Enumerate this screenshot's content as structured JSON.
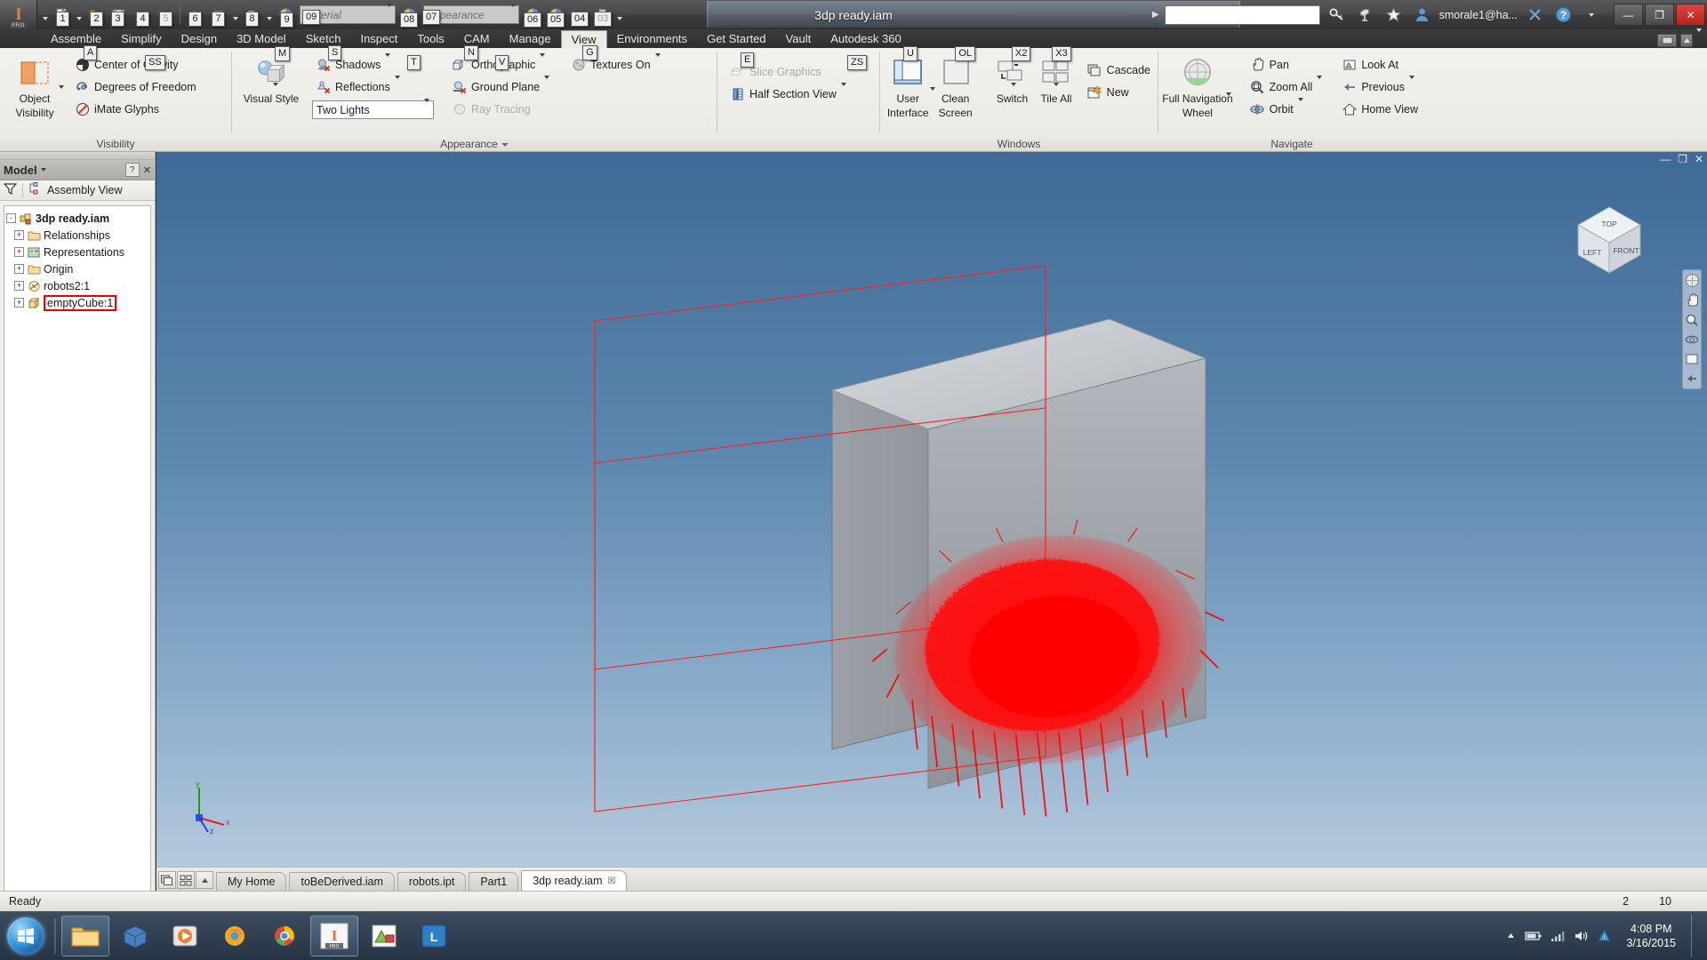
{
  "window": {
    "title": "3dp ready.iam",
    "user": "smorale1@ha...",
    "search_placeholder": "",
    "buttons": {
      "minimize": "—",
      "maximize": "❐",
      "close": "✕"
    }
  },
  "qat": {
    "material_placeholder": "Material",
    "appearance_placeholder": "Appearance",
    "keytips": [
      "1",
      "2",
      "3",
      "4",
      "5",
      "6",
      "7",
      "8",
      "9",
      "09",
      "08",
      "07",
      "06",
      "05",
      "04",
      "03"
    ]
  },
  "ribbon_tabs": [
    {
      "label": "Assemble",
      "active": false
    },
    {
      "label": "Simplify",
      "active": false
    },
    {
      "label": "Design",
      "active": false
    },
    {
      "label": "3D Model",
      "active": false
    },
    {
      "label": "Sketch",
      "active": false
    },
    {
      "label": "Inspect",
      "active": false
    },
    {
      "label": "Tools",
      "active": false
    },
    {
      "label": "CAM",
      "active": false
    },
    {
      "label": "Manage",
      "active": false
    },
    {
      "label": "View",
      "active": true
    },
    {
      "label": "Environments",
      "active": false
    },
    {
      "label": "Get Started",
      "active": false
    },
    {
      "label": "Vault",
      "active": false
    },
    {
      "label": "Autodesk 360",
      "active": false
    }
  ],
  "panels": [
    {
      "title": "Visibility",
      "big": {
        "label_line1": "Object",
        "label_line2": "Visibility",
        "icon": "object-visibility-icon",
        "keytip": null
      },
      "items": [
        {
          "label": "Center of Gravity",
          "icon": "center-of-gravity-icon",
          "keytip": "A",
          "arrow": false,
          "disabled": false
        },
        {
          "label": "Degrees of Freedom",
          "icon": "degrees-of-freedom-icon",
          "keytip": "SS",
          "arrow": false,
          "disabled": false
        },
        {
          "label": "iMate Glyphs",
          "icon": "imate-glyphs-icon",
          "keytip": null,
          "arrow": false,
          "disabled": false
        }
      ]
    },
    {
      "title": "Appearance",
      "has_title_arrow": true,
      "big": {
        "label_line1": "Visual Style",
        "label_line2": "",
        "icon": "visual-style-icon",
        "keytip": "M",
        "caret": true
      },
      "columns": [
        [
          {
            "label": "Shadows",
            "icon": "shadows-icon",
            "keytip": "S",
            "arrow": true,
            "disabled": false
          },
          {
            "label": "Reflections",
            "icon": "reflections-icon",
            "keytip": null,
            "arrow": true,
            "disabled": false
          },
          {
            "label": "Two Lights",
            "type": "combo",
            "keytip": null
          }
        ],
        [
          {
            "label": "Orthographic",
            "icon": "orthographic-icon",
            "keytip": "N",
            "arrow": true,
            "disabled": false
          },
          {
            "label": "Ground Plane",
            "icon": "ground-plane-icon",
            "keytip": "T",
            "arrow": true,
            "disabled": false
          },
          {
            "label": "Ray Tracing",
            "icon": "ray-tracing-icon",
            "keytip": null,
            "arrow": false,
            "disabled": true
          }
        ],
        [
          {
            "label": "Textures On",
            "icon": "textures-on-icon",
            "keytip": "G",
            "arrow": true,
            "disabled": false
          }
        ]
      ],
      "extra_keytip": "V"
    },
    {
      "title": "",
      "items": [
        {
          "label": "Slice Graphics",
          "icon": "slice-graphics-icon",
          "keytip": "E",
          "arrow": false,
          "disabled": true
        },
        {
          "label": "Half Section View",
          "icon": "half-section-view-icon",
          "keytip": "ZS",
          "arrow": true,
          "disabled": false
        }
      ]
    },
    {
      "title": "Windows",
      "bigs": [
        {
          "label_line1": "User",
          "label_line2": "Interface",
          "icon": "user-interface-icon",
          "keytip": "U",
          "caret": true
        },
        {
          "label_line1": "Clean",
          "label_line2": "Screen",
          "icon": "clean-screen-icon",
          "keytip": "OL",
          "caret": false
        },
        {
          "label_line1": "Switch",
          "label_line2": "",
          "icon": "switch-windows-icon",
          "keytip": "X2",
          "caret": true
        },
        {
          "label_line1": "Tile All",
          "label_line2": "",
          "icon": "tile-all-icon",
          "keytip": "X3",
          "caret": true
        }
      ],
      "items": [
        {
          "label": "Cascade",
          "icon": "cascade-icon",
          "keytip": null,
          "arrow": false,
          "disabled": false
        },
        {
          "label": "New",
          "icon": "new-window-icon",
          "keytip": null,
          "arrow": false,
          "disabled": false
        }
      ]
    },
    {
      "title": "Navigate",
      "big": {
        "label_line1": "Full Navigation",
        "label_line2": "Wheel",
        "icon": "navigation-wheel-icon",
        "keytip": null,
        "caret": true
      },
      "columns": [
        [
          {
            "label": "Pan",
            "icon": "pan-icon",
            "keytip": null,
            "arrow": false,
            "disabled": false
          },
          {
            "label": "Zoom All",
            "icon": "zoom-all-icon",
            "keytip": null,
            "arrow": true,
            "disabled": false
          },
          {
            "label": "Orbit",
            "icon": "orbit-icon",
            "keytip": null,
            "arrow": true,
            "disabled": false
          }
        ],
        [
          {
            "label": "Look At",
            "icon": "look-at-icon",
            "keytip": null,
            "arrow": false,
            "disabled": false
          },
          {
            "label": "Previous",
            "icon": "previous-view-icon",
            "keytip": null,
            "arrow": true,
            "disabled": false
          },
          {
            "label": "Home View",
            "icon": "home-view-icon",
            "keytip": null,
            "arrow": false,
            "disabled": false
          }
        ]
      ]
    }
  ],
  "browser": {
    "panel_label": "Model",
    "help_button": "?",
    "view_mode": "Assembly View",
    "filter_icon": "filter-icon",
    "tree": [
      {
        "label": "3dp ready.iam",
        "icon": "assembly-icon",
        "level": 0,
        "expander": "-",
        "root": true,
        "selected": false
      },
      {
        "label": "Relationships",
        "icon": "folder-icon",
        "level": 1,
        "expander": "+",
        "root": false,
        "selected": false
      },
      {
        "label": "Representations",
        "icon": "representations-icon",
        "level": 1,
        "expander": "+",
        "root": false,
        "selected": false
      },
      {
        "label": "Origin",
        "icon": "folder-icon",
        "level": 1,
        "expander": "+",
        "root": false,
        "selected": false
      },
      {
        "label": "robots2:1",
        "icon": "part-icon",
        "level": 1,
        "expander": "+",
        "root": false,
        "selected": false
      },
      {
        "label": "emptyCube:1",
        "icon": "cube-part-icon",
        "level": 1,
        "expander": "+",
        "root": false,
        "selected": true
      }
    ]
  },
  "viewport": {
    "viewcube_faces": {
      "top": "TOP",
      "front": "FRONT",
      "left": "LEFT"
    },
    "axis_labels": {
      "x": "x",
      "y": "y",
      "z": "z"
    },
    "nav_icons": [
      "full-navigation-wheel-icon",
      "pan-icon",
      "zoom-icon",
      "orbit-icon",
      "look-at-icon",
      "previous-view-icon"
    ],
    "model_colors": {
      "wireframe_box": "#ff2020",
      "solid_block": "#9aa0a4",
      "points": "#ff0000"
    },
    "window_buttons": {
      "minimize": "—",
      "restore": "❐",
      "close": "✕"
    }
  },
  "doc_tabs": [
    {
      "label": "My Home",
      "active": false,
      "closable": false
    },
    {
      "label": "toBeDerived.iam",
      "active": false,
      "closable": false
    },
    {
      "label": "robots.ipt",
      "active": false,
      "closable": false
    },
    {
      "label": "Part1",
      "active": false,
      "closable": false
    },
    {
      "label": "3dp ready.iam",
      "active": true,
      "closable": true
    }
  ],
  "statusbar": {
    "message": "Ready",
    "value_left": "2",
    "value_right": "10"
  },
  "taskbar": {
    "start_label": "start",
    "items": [
      {
        "name": "file-explorer",
        "running": true
      },
      {
        "name": "inventor-viewer",
        "running": false
      },
      {
        "name": "media-player",
        "running": false
      },
      {
        "name": "firefox",
        "running": false
      },
      {
        "name": "chrome",
        "running": false
      },
      {
        "name": "inventor-professional",
        "running": true
      },
      {
        "name": "cad-app",
        "running": false
      },
      {
        "name": "blue-app",
        "running": false
      }
    ],
    "tray_icons": [
      "show-hidden-icon",
      "battery-icon",
      "network-icon",
      "volume-icon",
      "action-center-icon"
    ],
    "clock_time": "4:08 PM",
    "clock_date": "3/16/2015"
  }
}
